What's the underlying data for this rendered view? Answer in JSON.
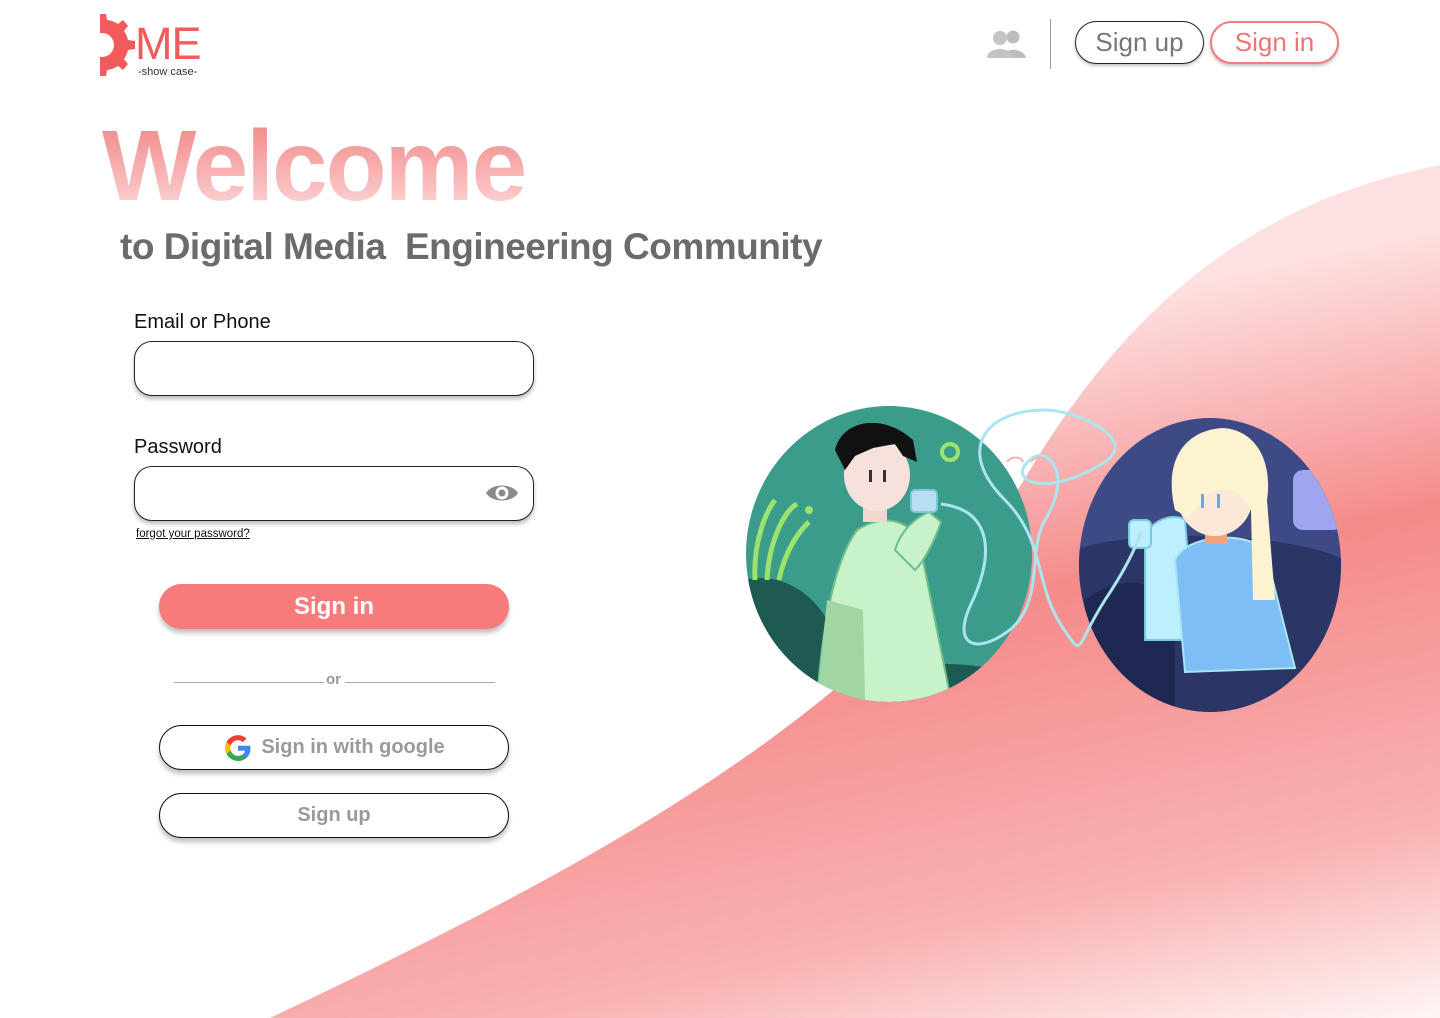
{
  "logo": {
    "mark": "ME",
    "tagline": "-show case-",
    "icon": "gear-icon"
  },
  "nav": {
    "community_icon": "people-icon",
    "signup_label": "Sign up",
    "signin_label": "Sign in"
  },
  "hero": {
    "title": "Welcome",
    "subtitle": "to Digital Media  Engineering Community"
  },
  "form": {
    "email_label": "Email or Phone",
    "email_value": "",
    "password_label": "Password",
    "password_value": "",
    "password_toggle_icon": "eye-icon",
    "forgot_label": "forgot your password?",
    "signin_button": "Sign in",
    "divider_text": "or",
    "google_button": "Sign in with google",
    "google_icon": "google-g-icon",
    "signup_button": "Sign up"
  },
  "colors": {
    "accent": "#f77b7b",
    "brand": "#f25b5b",
    "wave": "#f58a8a"
  }
}
